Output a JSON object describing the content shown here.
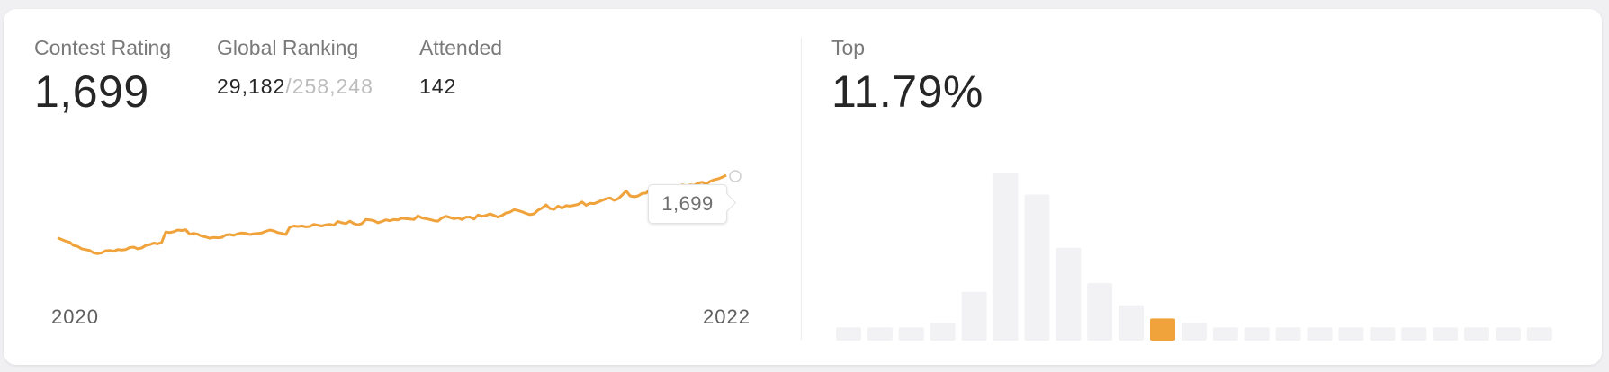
{
  "stats": {
    "contest_rating_label": "Contest Rating",
    "contest_rating_value": "1,699",
    "global_ranking_label": "Global Ranking",
    "global_ranking_rank": "29,182",
    "global_ranking_total": "/258,248",
    "attended_label": "Attended",
    "attended_value": "142",
    "top_label": "Top",
    "top_value": "11.79%"
  },
  "tooltip": {
    "value": "1,699"
  },
  "colors": {
    "accent": "#f0a23b",
    "bar": "#f2f2f4",
    "bar_highlight": "#f0a23b"
  },
  "chart_data": [
    {
      "type": "line",
      "x_tick_labels": [
        "2020",
        "2022"
      ],
      "highlighted_point": "1,699",
      "values": [
        1545,
        1541,
        1537,
        1534,
        1526,
        1524,
        1518,
        1516,
        1514,
        1508,
        1506,
        1508,
        1513,
        1514,
        1512,
        1516,
        1515,
        1516,
        1521,
        1522,
        1518,
        1520,
        1526,
        1528,
        1532,
        1530,
        1534,
        1559,
        1558,
        1560,
        1564,
        1563,
        1565,
        1554,
        1556,
        1554,
        1549,
        1547,
        1544,
        1546,
        1545,
        1546,
        1552,
        1553,
        1551,
        1555,
        1557,
        1556,
        1553,
        1555,
        1556,
        1557,
        1561,
        1564,
        1562,
        1558,
        1556,
        1553,
        1571,
        1574,
        1573,
        1574,
        1572,
        1573,
        1578,
        1576,
        1574,
        1577,
        1578,
        1576,
        1585,
        1582,
        1580,
        1586,
        1580,
        1577,
        1580,
        1590,
        1589,
        1587,
        1582,
        1585,
        1589,
        1587,
        1590,
        1589,
        1593,
        1592,
        1591,
        1590,
        1599,
        1594,
        1592,
        1590,
        1587,
        1586,
        1594,
        1598,
        1595,
        1592,
        1594,
        1590,
        1596,
        1596,
        1591,
        1601,
        1598,
        1600,
        1604,
        1600,
        1596,
        1600,
        1606,
        1608,
        1614,
        1612,
        1609,
        1605,
        1602,
        1604,
        1613,
        1618,
        1626,
        1617,
        1615,
        1623,
        1618,
        1624,
        1623,
        1625,
        1627,
        1633,
        1625,
        1630,
        1629,
        1633,
        1637,
        1641,
        1643,
        1637,
        1641,
        1650,
        1660,
        1648,
        1646,
        1648,
        1654,
        1655,
        1664,
        1654,
        1660,
        1662,
        1658,
        1655,
        1652,
        1665,
        1675,
        1673,
        1675,
        1674,
        1680,
        1682,
        1678,
        1684,
        1688,
        1690,
        1694,
        1699
      ]
    },
    {
      "type": "bar",
      "values": [
        3,
        3,
        3,
        4,
        11,
        38,
        33,
        21,
        13,
        8,
        5,
        4,
        3,
        3,
        3,
        3,
        3,
        3,
        3,
        3,
        3,
        3,
        3
      ],
      "highlight_index": 10,
      "ylim": [
        0,
        40
      ]
    }
  ]
}
